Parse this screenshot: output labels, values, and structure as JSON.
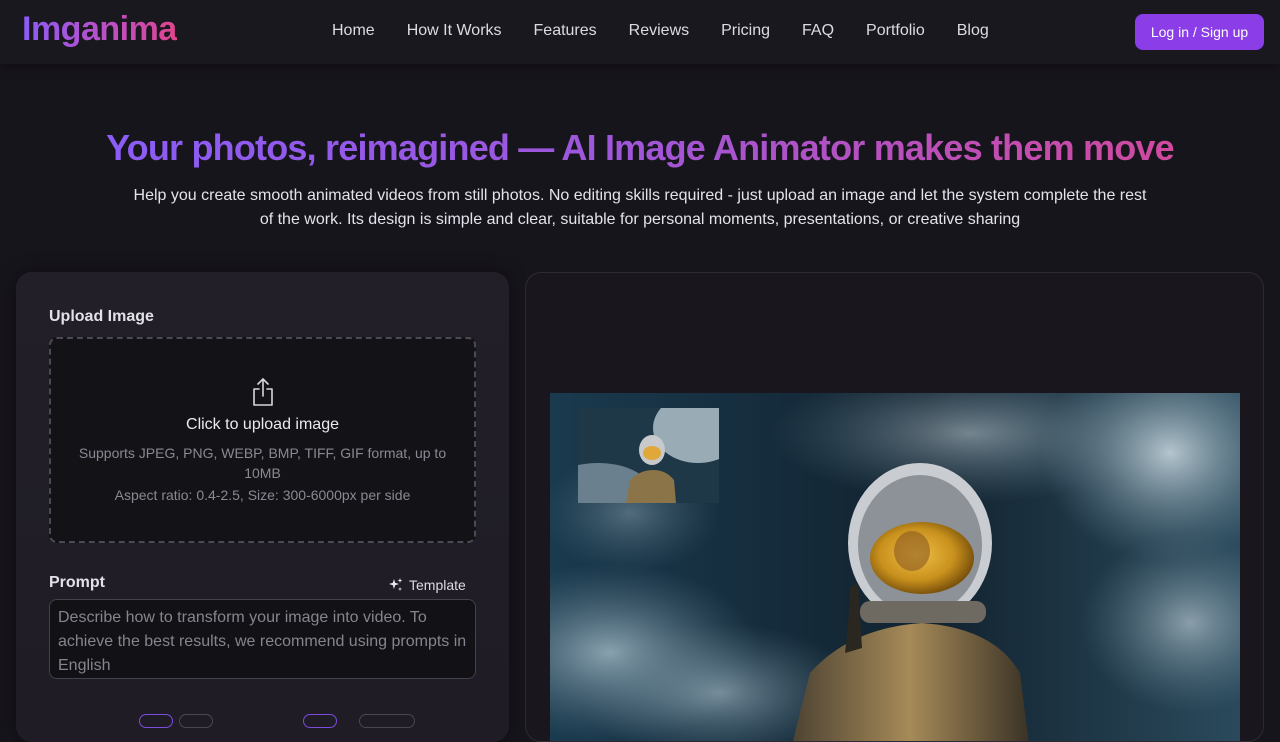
{
  "header": {
    "logo": "Imganima",
    "nav": [
      "Home",
      "How It Works",
      "Features",
      "Reviews",
      "Pricing",
      "FAQ",
      "Portfolio",
      "Blog"
    ],
    "login_label": "Log in / Sign up"
  },
  "hero": {
    "title": "Your photos, reimagined — AI Image Animator makes them move",
    "subtitle": "Help you create smooth animated videos from still photos. No editing skills required - just upload an image and let the system complete the rest of the work. Its design is simple and clear, suitable for personal moments, presentations, or creative sharing"
  },
  "upload": {
    "label": "Upload Image",
    "title": "Click to upload image",
    "formats": "Supports JPEG, PNG, WEBP, BMP, TIFF, GIF format, up to 10MB",
    "constraints": "Aspect ratio: 0.4-2.5, Size: 300-6000px per side",
    "icon": "upload-icon"
  },
  "prompt": {
    "label": "Prompt",
    "template_label": "Template",
    "placeholder": "Describe how to transform your image into video. To achieve the best results, we recommend using prompts in English"
  },
  "colors": {
    "accent": "#8b3ee8",
    "background": "#17151c",
    "gradient_start": "#8b5cf6",
    "gradient_end": "#e0458f"
  }
}
